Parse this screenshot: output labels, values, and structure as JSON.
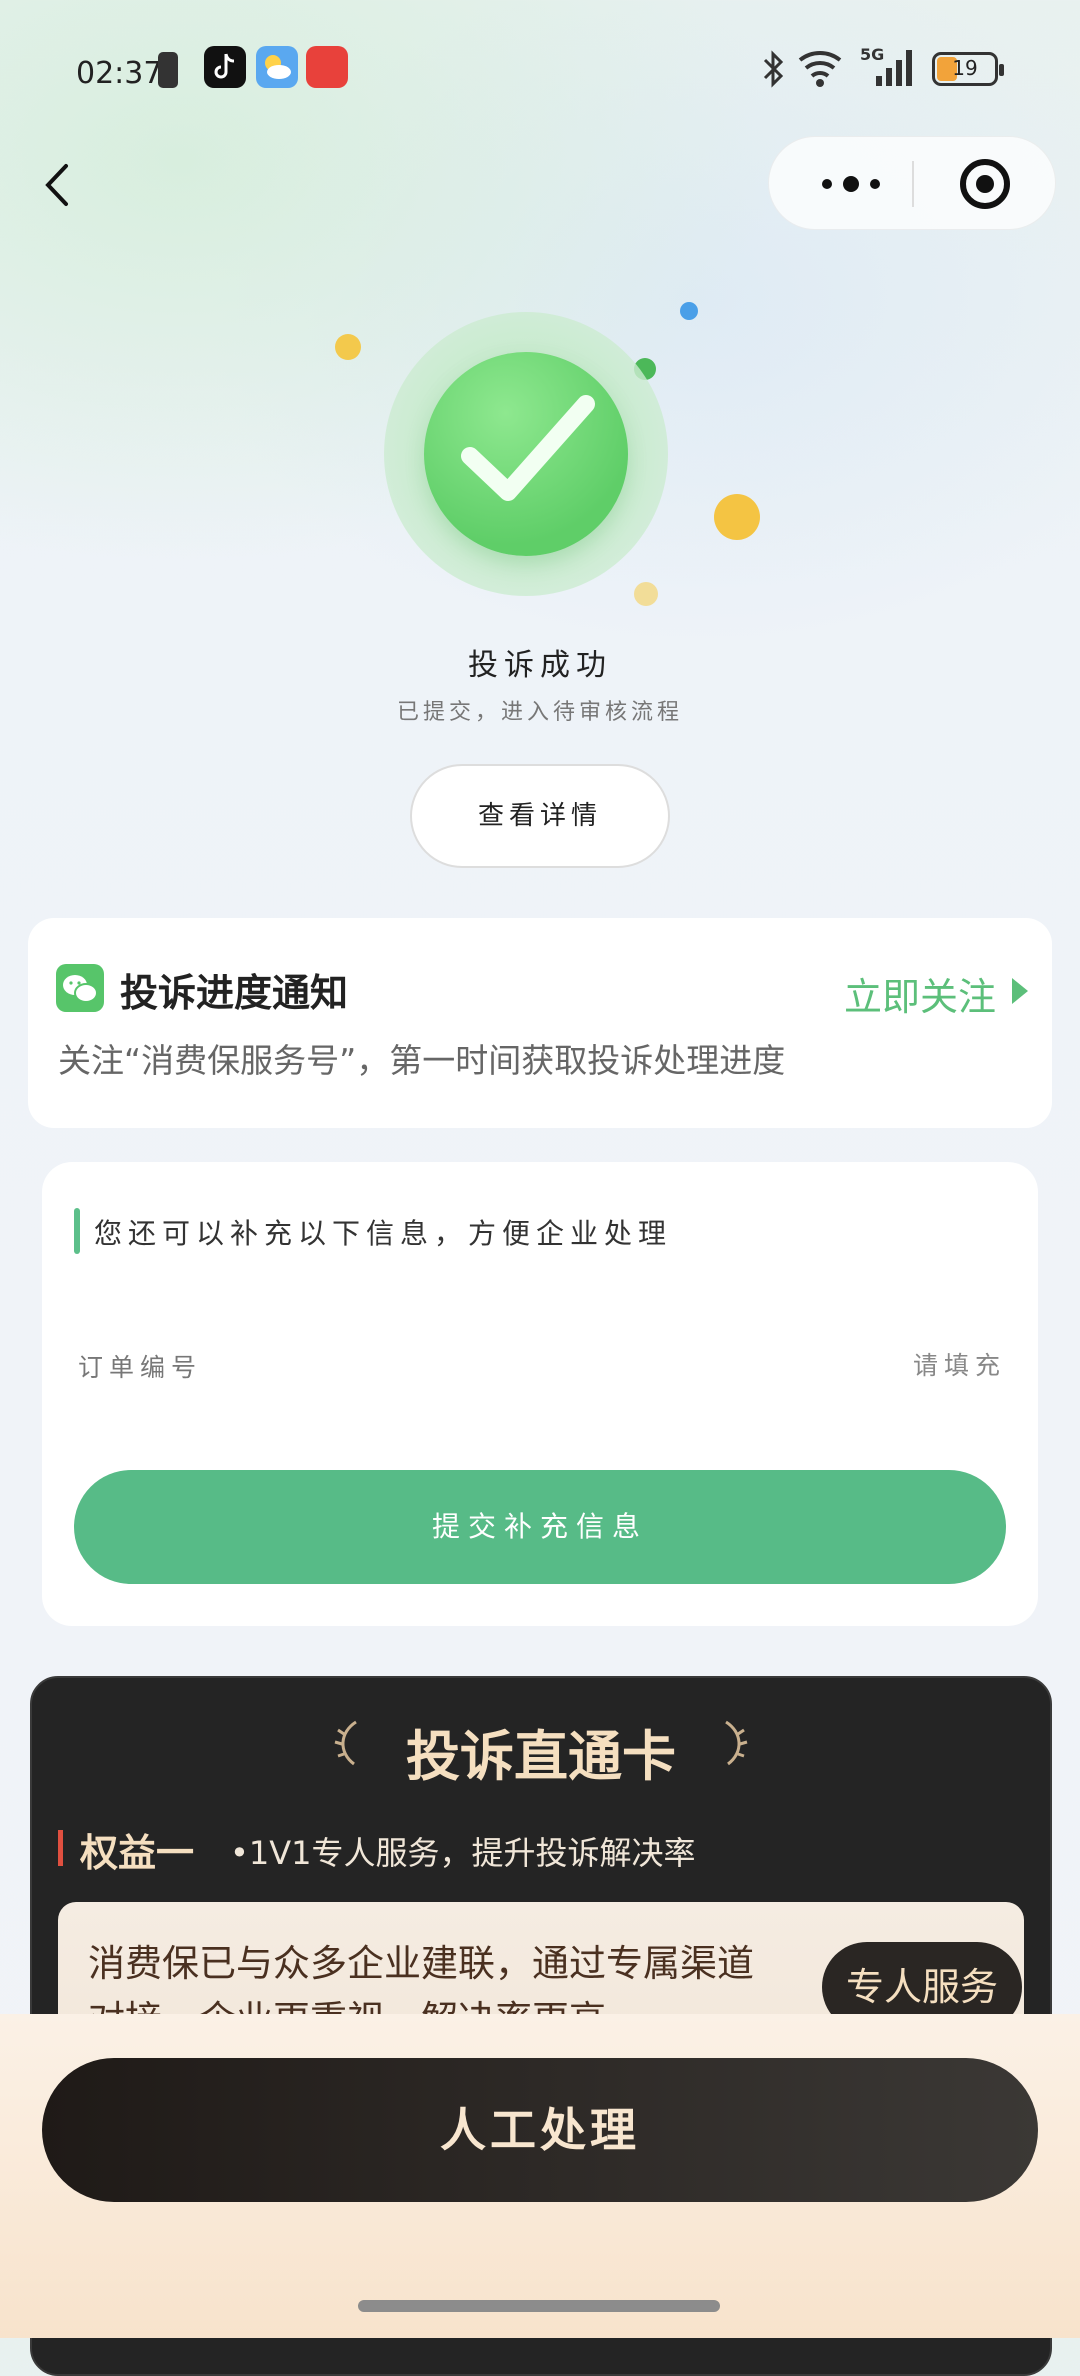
{
  "status_bar": {
    "time": "02:37",
    "battery": "19",
    "network": "5G"
  },
  "nav": {
    "back_icon": "chevron-left-icon",
    "more_icon": "more-dots-icon",
    "close_icon": "target-circle-icon"
  },
  "success": {
    "title": "投诉成功",
    "subtitle": "已提交，进入待审核流程",
    "detail_button": "查看详情",
    "accent_color": "#5fce68"
  },
  "notify_card": {
    "title": "投诉进度通知",
    "follow_label": "立即关注",
    "description": "关注“消费保服务号”，第一时间获取投诉处理进度"
  },
  "supplement_card": {
    "title": "您还可以补充以下信息，方便企业处理",
    "field_label": "订单编号",
    "field_placeholder": "请填充",
    "field_value": "",
    "submit_label": "提交补充信息",
    "submit_color": "#57bb87"
  },
  "direct_card": {
    "title": "投诉直通卡",
    "benefit_title": "权益一",
    "benefit_desc": "•1V1专人服务，提升投诉解决率",
    "benefit_text": "消费保已与众多企业建联，通过专属渠道对接，企业更重视，解决率更高",
    "expert_button": "专人服务"
  },
  "bottom": {
    "manual_button": "人工处理"
  }
}
